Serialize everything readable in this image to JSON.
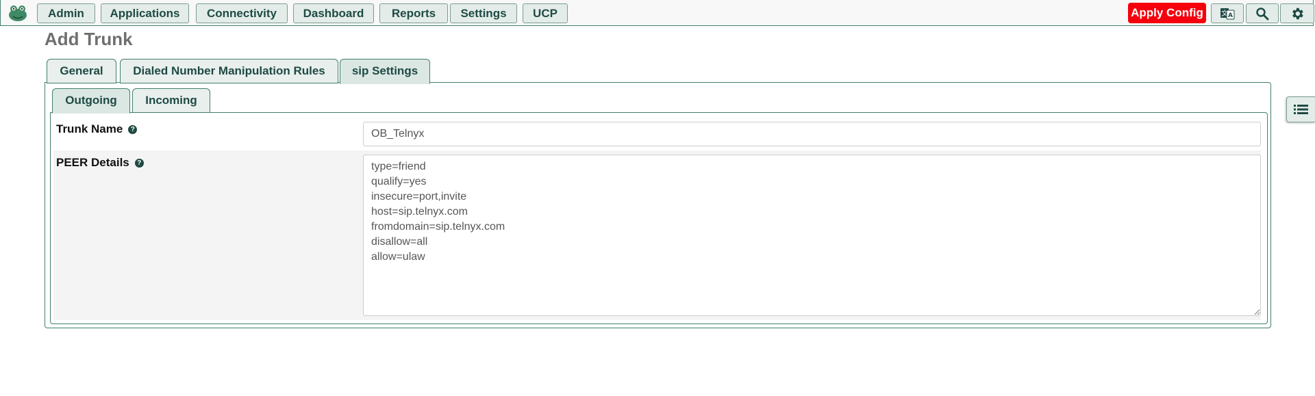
{
  "nav": {
    "items": [
      "Admin",
      "Applications",
      "Connectivity",
      "Dashboard",
      "Reports",
      "Settings",
      "UCP"
    ],
    "apply_config": "Apply Config",
    "icons": [
      "translate-icon",
      "search-icon",
      "gear-icon"
    ]
  },
  "page": {
    "title": "Add Trunk"
  },
  "tabs": [
    "General",
    "Dialed Number Manipulation Rules",
    "sip Settings"
  ],
  "active_tab": "sip Settings",
  "subtabs": [
    "Outgoing",
    "Incoming"
  ],
  "active_subtab": "Outgoing",
  "form": {
    "trunk_name_label": "Trunk Name",
    "trunk_name_value": "OB_Telnyx",
    "peer_details_label": "PEER Details",
    "peer_details_value": "type=friend\nqualify=yes\ninsecure=port,invite\nhost=sip.telnyx.com\nfromdomain=sip.telnyx.com\ndisallow=all\nallow=ulaw",
    "help_glyph": "?"
  },
  "colors": {
    "accent": "#3f7f6a",
    "apply": "#f5000c",
    "nav_text": "#1f4a44"
  },
  "side_button_icon": "list-icon"
}
